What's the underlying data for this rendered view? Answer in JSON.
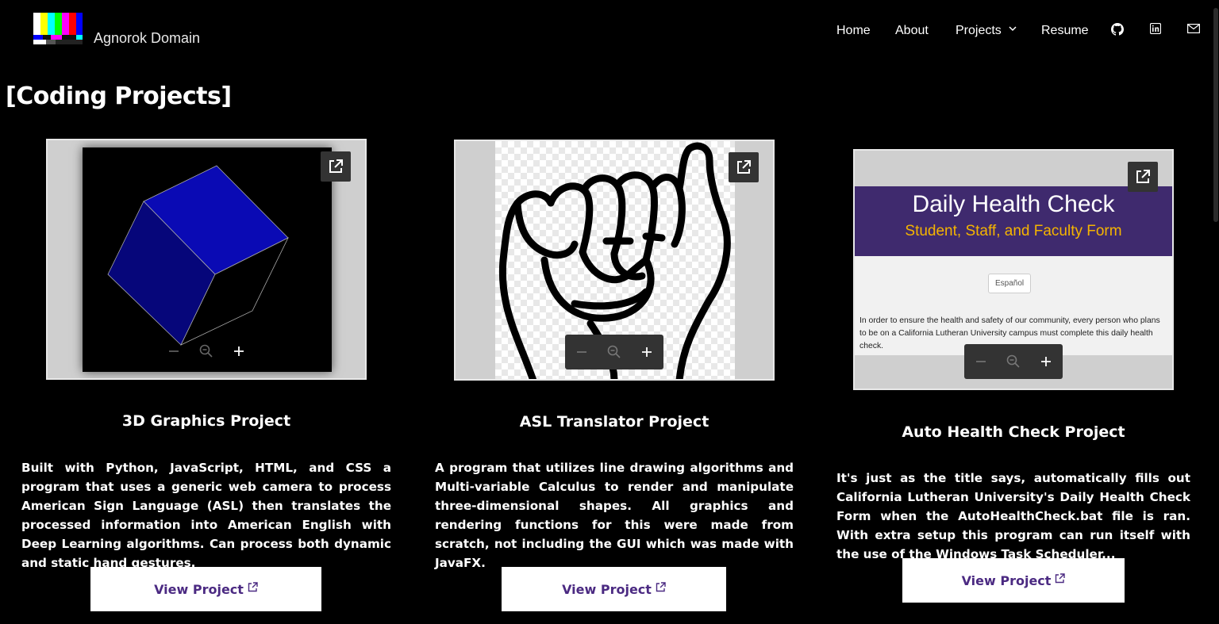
{
  "header": {
    "brand": "Agnorok Domain",
    "nav": [
      "Home",
      "About",
      "Projects",
      "Resume"
    ],
    "icons": [
      "github-icon",
      "linkedin-icon",
      "mail-icon"
    ]
  },
  "page_title": "[Coding Projects]",
  "cards": [
    {
      "title": "3D Graphics Project",
      "description": "Built with Python, JavaScript, HTML, and CSS a program that uses a generic web camera to process American Sign Language (ASL) then translates the processed information into American English with Deep Learning algorithms.  Can process both dynamic and static hand gestures.",
      "button": "View Project"
    },
    {
      "title": "ASL Translator Project",
      "description": "A program that utilizes line drawing algorithms and Multi-variable Calculus to render and manipulate three-dimensional shapes. All graphics and rendering functions for this were made from scratch, not including the GUI which was made with JavaFX.",
      "button": "View Project"
    },
    {
      "title": "Auto Health Check Project",
      "description": "It's just as the title says, automatically fills out California Lutheran University's Daily Health Check Form  when the AutoHealthCheck.bat file is ran. With extra setup this program can run itself with the use of the  Windows Task Scheduler...",
      "button": "View Project"
    }
  ],
  "health_check_preview": {
    "title": "Daily Health Check",
    "subtitle": "Student, Staff, and Faculty Form",
    "language_button": "Español",
    "body": "In order to ensure the health and safety of our community, every person who plans to be on a California Lutheran University campus must complete this daily health check."
  },
  "colors": {
    "background": "#000000",
    "button_text": "#4b2a82",
    "hc_banner": "#3f2a6e",
    "hc_subtitle": "#f5b400",
    "cube": "#0a0ab4"
  }
}
